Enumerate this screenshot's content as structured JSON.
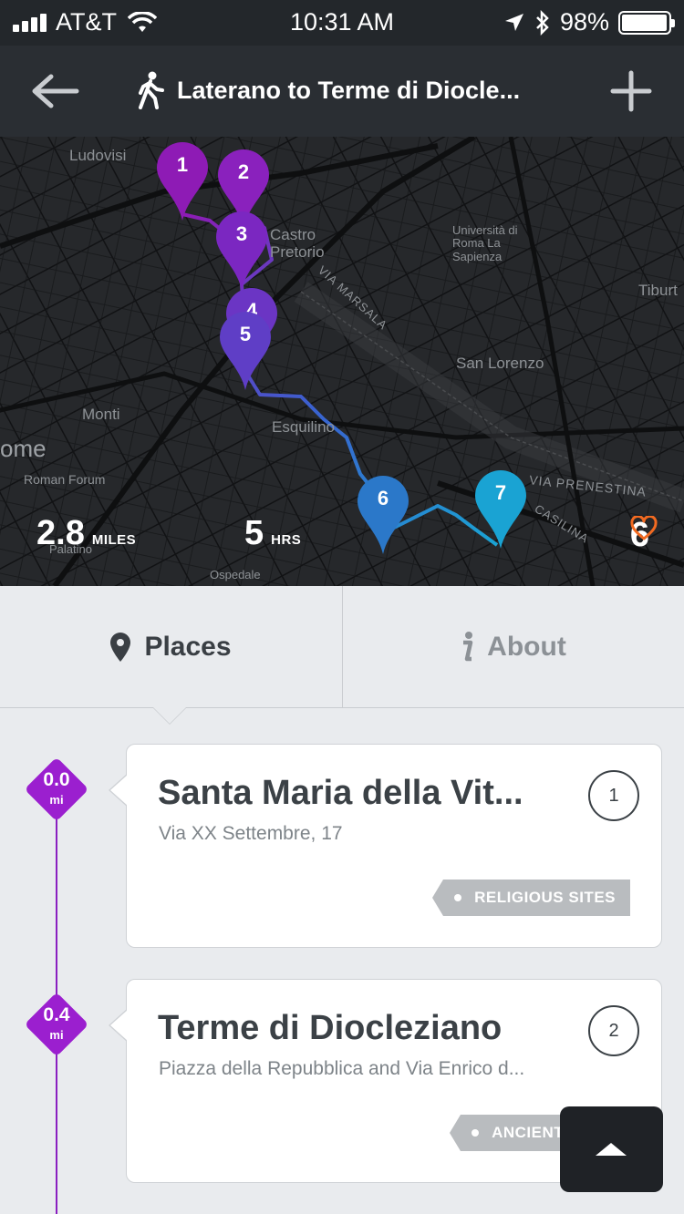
{
  "status_bar": {
    "carrier": "AT&T",
    "time": "10:31 AM",
    "battery": "98%",
    "battery_level": 0.98
  },
  "nav": {
    "title": "Laterano to Terme di Diocle..."
  },
  "map": {
    "labels": {
      "ludovisi": "Ludovisi",
      "castro": "Castro\nPretorio",
      "universita": "Università di\nRoma La\nSapienza",
      "via_marsala": "VIA MARSALA",
      "tiburt": "Tiburt",
      "san_lorenzo": "San Lorenzo",
      "monti": "Monti",
      "esquilino": "Esquilino",
      "rome": "ome",
      "roman_forum": "Roman Forum",
      "via_prenestina": "VIA PRENESTINA",
      "casilina": "CASILINA",
      "palatino": "Palatino",
      "ospedale": "Ospedale"
    },
    "pins": [
      {
        "number": "1",
        "color": "#8e1bb5"
      },
      {
        "number": "2",
        "color": "#8a21bd"
      },
      {
        "number": "3",
        "color": "#7b27c1"
      },
      {
        "number": "4",
        "color": "#6b35c4"
      },
      {
        "number": "5",
        "color": "#5f3ec6"
      },
      {
        "number": "6",
        "color": "#2b78c9"
      },
      {
        "number": "7",
        "color": "#1aa3d3"
      }
    ],
    "distance": {
      "value": "2.8",
      "unit": "MILES"
    },
    "duration": {
      "value": "5",
      "unit": "HRS"
    },
    "favorites": "6"
  },
  "tabs": {
    "places": "Places",
    "about": "About"
  },
  "places": [
    {
      "distance": "0.0",
      "unit": "mi",
      "title": "Santa Maria della Vit...",
      "address": "Via XX Settembre, 17",
      "number": "1",
      "tag": "RELIGIOUS SITES"
    },
    {
      "distance": "0.4",
      "unit": "mi",
      "title": "Terme di Diocleziano",
      "address": "Piazza della Repubblica and Via Enrico d...",
      "number": "2",
      "tag": "ANCIENT SITES"
    }
  ],
  "colors": {
    "accent_purple": "#9b1fcf",
    "favorite_orange": "#f26a21",
    "route_start": "#8e1bb5",
    "route_end": "#1aa3d3"
  }
}
